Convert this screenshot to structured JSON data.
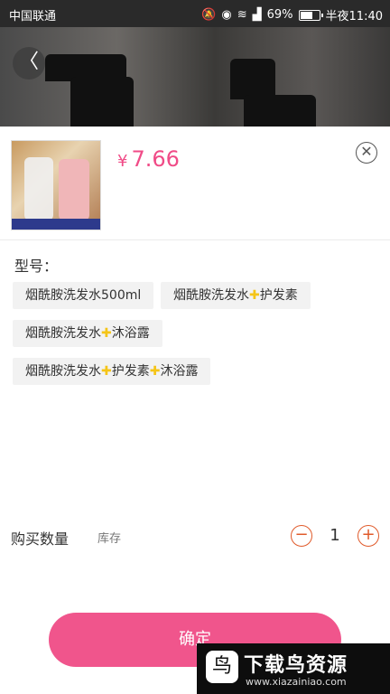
{
  "status_bar": {
    "carrier": "中国联通",
    "battery": "69%",
    "battery_level": 0.69,
    "time": "半夜11:40",
    "icons": [
      "mute-icon",
      "eye-icon",
      "wifi-icon",
      "signal-icon",
      "battery-icon"
    ]
  },
  "header": {
    "back_icon": "chevron-left-icon",
    "back_glyph": "〈"
  },
  "product": {
    "currency": "¥",
    "price": "7.66",
    "close_glyph": "✕"
  },
  "spec": {
    "label": "型号：",
    "options": [
      {
        "parts": [
          "烟酰胺洗发水500ml"
        ]
      },
      {
        "parts": [
          "烟酰胺洗发水",
          "护发素"
        ]
      },
      {
        "parts": [
          "烟酰胺洗发水",
          "沐浴露"
        ]
      },
      {
        "parts": [
          "烟酰胺洗发水",
          "护发素",
          "沐浴露"
        ]
      }
    ],
    "plus_glyph": "✚",
    "plus_color": "#f5c518"
  },
  "quantity": {
    "label": "购买数量",
    "stock_label": "库存",
    "minus": "−",
    "plus": "+",
    "value": "1"
  },
  "confirm_label": "确定",
  "watermark": {
    "title": "下载鸟资源",
    "url": "www.xiazainiao.com"
  },
  "colors": {
    "accent": "#f04b87",
    "button": "#f0558c",
    "stepper": "#e05a2a"
  }
}
